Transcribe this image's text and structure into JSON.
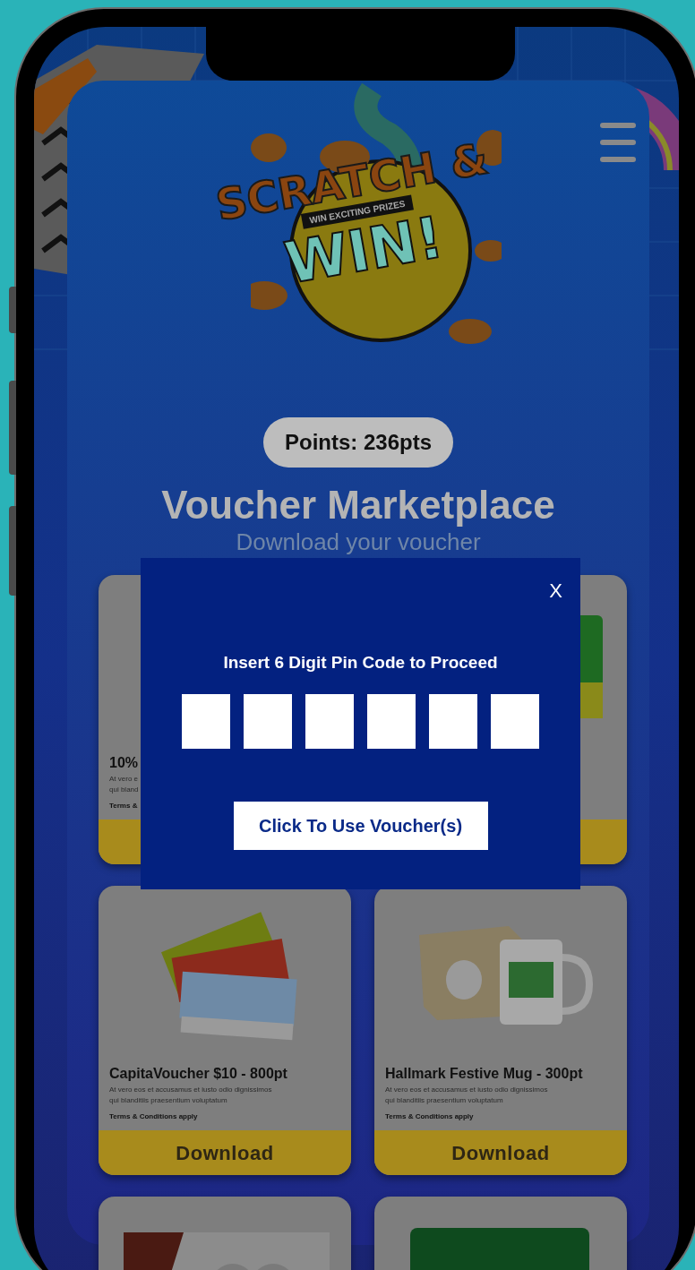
{
  "logo": {
    "title_top": "SCRATCH &",
    "tagline": "WIN EXCITING PRIZES",
    "title_bottom": "WIN!"
  },
  "points": "Points: 236pts",
  "heading": "Voucher Marketplace",
  "subheading": "Download your voucher",
  "cards": [
    {
      "kind": "product",
      "title": "10%",
      "description": [
        "At vero e",
        "qui bland"
      ],
      "terms": "Terms &"
    },
    {
      "kind": "picture"
    },
    {
      "kind": "product",
      "title": "CapitaVoucher $10 - 800pt",
      "description": [
        "At vero eos et accusamus et iusto odio dignissimos",
        "qui blanditiis praesentium voluptatum"
      ],
      "terms": "Terms & Conditions apply",
      "button": "Download"
    },
    {
      "kind": "product",
      "title": "Hallmark Festive Mug - 300pt",
      "description": [
        "At vero eos et accusamus et iusto odio dignissimos",
        "qui blanditiis praesentium voluptatum"
      ],
      "terms": "Terms & Conditions apply",
      "button": "Download"
    },
    {
      "kind": "picture"
    },
    {
      "kind": "picture"
    }
  ],
  "modal": {
    "close": "X",
    "prompt": "Insert 6 Digit Pin Code to Proceed",
    "pin_fields": [
      {
        "filled": false
      },
      {
        "filled": false
      },
      {
        "filled": false
      },
      {
        "filled": false
      },
      {
        "filled": false
      },
      {
        "filled": false
      }
    ],
    "button": "Click To Use Voucher(s)"
  }
}
